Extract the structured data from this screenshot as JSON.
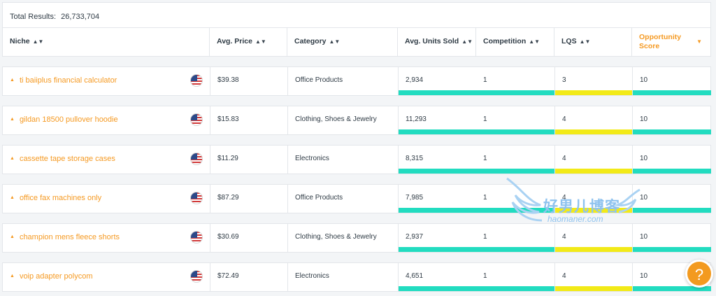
{
  "summary": {
    "label": "Total Results:",
    "value": "26,733,704"
  },
  "columns": [
    {
      "label": "Niche",
      "sort": "▲▼"
    },
    {
      "label": "Avg. Price",
      "sort": "▲▼"
    },
    {
      "label": "Category",
      "sort": "▲▼"
    },
    {
      "label": "Avg. Units Sold",
      "sort": "▲▼"
    },
    {
      "label": "Competition",
      "sort": "▲▼"
    },
    {
      "label": "LQS",
      "sort": "▲▼"
    },
    {
      "label": "Opportunity Score",
      "sort": "▼",
      "active": true
    }
  ],
  "rows": [
    {
      "niche": "ti baiiplus financial calculator",
      "price": "$39.38",
      "category": "Office Products",
      "units": "2,934",
      "competition": "1",
      "lqs": "3",
      "opportunity": "10"
    },
    {
      "niche": "gildan 18500 pullover hoodie",
      "price": "$15.83",
      "category": "Clothing, Shoes & Jewelry",
      "units": "11,293",
      "competition": "1",
      "lqs": "4",
      "opportunity": "10"
    },
    {
      "niche": "cassette tape storage cases",
      "price": "$11.29",
      "category": "Electronics",
      "units": "8,315",
      "competition": "1",
      "lqs": "4",
      "opportunity": "10"
    },
    {
      "niche": "office fax machines only",
      "price": "$87.29",
      "category": "Office Products",
      "units": "7,985",
      "competition": "1",
      "lqs": "4",
      "opportunity": "10"
    },
    {
      "niche": "champion mens fleece shorts",
      "price": "$30.69",
      "category": "Clothing, Shoes & Jewelry",
      "units": "2,937",
      "competition": "1",
      "lqs": "4",
      "opportunity": "10"
    },
    {
      "niche": "voip adapter polycom",
      "price": "$72.49",
      "category": "Electronics",
      "units": "4,651",
      "competition": "1",
      "lqs": "4",
      "opportunity": "10"
    }
  ],
  "icons": {
    "expand": "caret-up-icon",
    "marketplace": "us-flag-icon",
    "help": "question-mark-icon"
  },
  "colors": {
    "accent": "#f59a23",
    "good": "#22dcc0",
    "medium": "#f2ea18"
  },
  "help": {
    "symbol": "?"
  },
  "watermark": {
    "title": "好男儿博客",
    "site": "haomaner.com"
  }
}
